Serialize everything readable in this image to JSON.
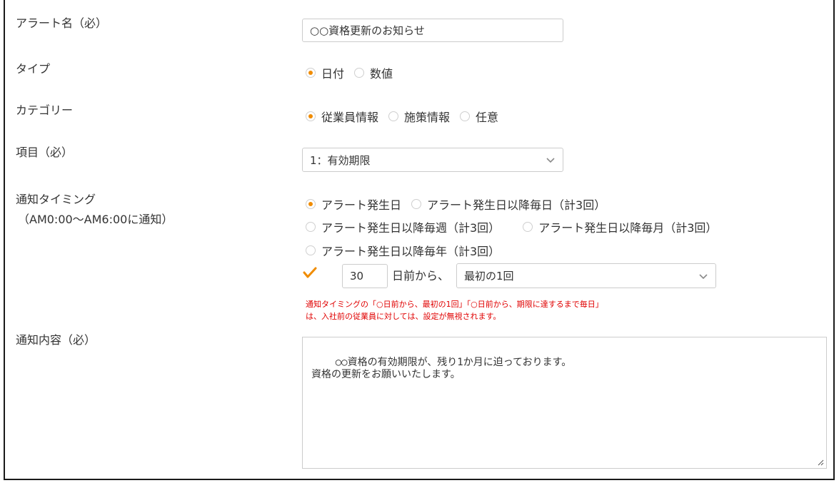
{
  "form": {
    "alert_name": {
      "label": "アラート名（必）",
      "value": "○○資格更新のお知らせ"
    },
    "type": {
      "label": "タイプ",
      "options": [
        "日付",
        "数値"
      ],
      "selected": "日付"
    },
    "category": {
      "label": "カテゴリー",
      "options": [
        "従業員情報",
        "施策情報",
        "任意"
      ],
      "selected": "従業員情報"
    },
    "item": {
      "label": "項目（必）",
      "value": "1：有効期限"
    },
    "timing": {
      "label": "通知タイミング",
      "sublabel": "（AM0:00～AM6:00に通知）",
      "options": [
        "アラート発生日",
        "アラート発生日以降毎日（計3回）",
        "アラート発生日以降毎週（計3回）",
        "アラート発生日以降毎月（計3回）",
        "アラート発生日以降毎年（計3回）"
      ],
      "selected": "アラート発生日",
      "days_before": "30",
      "days_suffix": "日前から、",
      "frequency": "最初の1回",
      "note_line1": "通知タイミングの「○日前から、最初の1回」「○日前から、期限に達するまで毎日」",
      "note_line2": "は、入社前の従業員に対しては、設定が無視されます。"
    },
    "content": {
      "label": "通知内容（必）",
      "value": "○○資格の有効期限が、残り1か月に迫っております。\n資格の更新をお願いいたします。"
    }
  },
  "colors": {
    "accent": "#f08c00",
    "warning": "#e00000",
    "border": "#cccccc"
  },
  "icons": [
    "chevron-down-icon",
    "check-icon",
    "resize-grip-icon"
  ]
}
